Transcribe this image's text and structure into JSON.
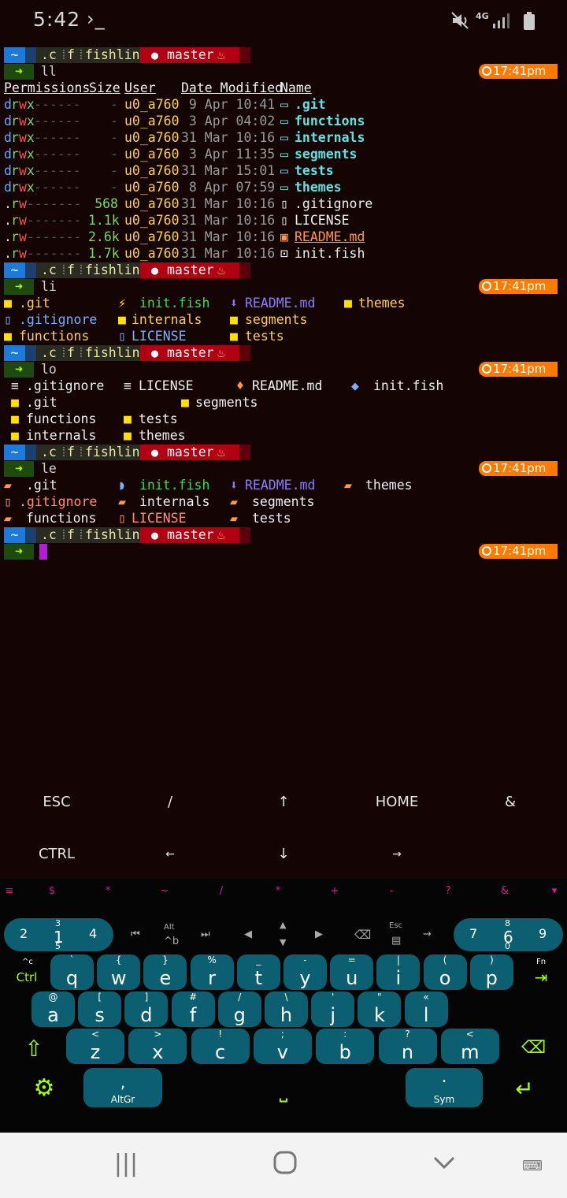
{
  "status": {
    "time": "5:42",
    "term_icon": "›_",
    "signal_label": "4G"
  },
  "prompt": {
    "home": "~",
    "path1": ".c",
    "path2": "f",
    "path3": "fishline",
    "branch": "master",
    "clock": "17:41pm",
    "arrow": "➜"
  },
  "cmds": {
    "c1": "ll",
    "c2": "li",
    "c3": "lo",
    "c4": "le"
  },
  "ll": {
    "headers": {
      "perm": "Permissions",
      "size": "Size",
      "user": "User",
      "date": "Date Modified",
      "name": "Name"
    },
    "rows": [
      {
        "d": "d",
        "rwx": "rwx",
        "rest": "------",
        "size": "-",
        "user": "u0_a760",
        "date": " 9 Apr 10:41",
        "name": ".git",
        "type": "dir"
      },
      {
        "d": "d",
        "rwx": "rwx",
        "rest": "------",
        "size": "-",
        "user": "u0_a760",
        "date": " 3 Apr 04:02",
        "name": "functions",
        "type": "dir"
      },
      {
        "d": "d",
        "rwx": "rwx",
        "rest": "------",
        "size": "-",
        "user": "u0_a760",
        "date": "31 Mar 10:16",
        "name": "internals",
        "type": "dir"
      },
      {
        "d": "d",
        "rwx": "rwx",
        "rest": "------",
        "size": "-",
        "user": "u0_a760",
        "date": " 3 Apr 11:35",
        "name": "segments",
        "type": "dir"
      },
      {
        "d": "d",
        "rwx": "rwx",
        "rest": "------",
        "size": "-",
        "user": "u0_a760",
        "date": "31 Mar 15:01",
        "name": "tests",
        "type": "dir"
      },
      {
        "d": "d",
        "rwx": "rwx",
        "rest": "------",
        "size": "-",
        "user": "u0_a760",
        "date": " 8 Apr 07:59",
        "name": "themes",
        "type": "dir"
      },
      {
        "d": ".",
        "rwx": "rw",
        "rest": "-------",
        "size": "568",
        "user": "u0_a760",
        "date": "31 Mar 10:16",
        "name": ".gitignore",
        "type": "file"
      },
      {
        "d": ".",
        "rwx": "rw",
        "rest": "-------",
        "size": "1.1k",
        "user": "u0_a760",
        "date": "31 Mar 10:16",
        "name": "LICENSE",
        "type": "file"
      },
      {
        "d": ".",
        "rwx": "rw",
        "rest": "-------",
        "size": "2.6k",
        "user": "u0_a760",
        "date": "31 Mar 10:16",
        "name": "README.md",
        "type": "md"
      },
      {
        "d": ".",
        "rwx": "rw",
        "rest": "-------",
        "size": "1.7k",
        "user": "u0_a760",
        "date": "31 Mar 10:16",
        "name": "init.fish",
        "type": "fish"
      }
    ]
  },
  "names": {
    "git": ".git",
    "gitignore": ".gitignore",
    "functions": "functions",
    "internals": "internals",
    "license": "LICENSE",
    "initfish": "init.fish",
    "readme": "README.md",
    "segments": "segments",
    "tests": "tests",
    "themes": "themes"
  },
  "extra_keys": {
    "esc": "ESC",
    "slash": "/",
    "up": "↑",
    "home": "HOME",
    "amp": "&",
    "ctrl": "CTRL",
    "left": "←",
    "down": "↓",
    "right": "→"
  },
  "symbols": [
    "≡",
    "$",
    "*",
    "~",
    "/",
    "*",
    "+",
    "-",
    "?",
    "&",
    "▾"
  ],
  "keyboard": {
    "num_left": {
      "a": "2",
      "b": "1",
      "b_up": "3",
      "b_dn": "5",
      "c": "4"
    },
    "num_right": {
      "a": "7",
      "b": "6",
      "b_up": "8",
      "b_dn": "0",
      "c": "9"
    },
    "mid": {
      "alt": "Alt",
      "altb": "^b",
      "esc": "Esc"
    },
    "row1": [
      {
        "k": "q",
        "s": "`"
      },
      {
        "k": "w",
        "s": "{"
      },
      {
        "k": "e",
        "s": "}"
      },
      {
        "k": "r",
        "s": "%"
      },
      {
        "k": "t",
        "s": "_"
      },
      {
        "k": "y",
        "s": "-"
      },
      {
        "k": "u",
        "s": "="
      },
      {
        "k": "i",
        "s": "|"
      },
      {
        "k": "o",
        "s": "("
      },
      {
        "k": "p",
        "s": ")"
      }
    ],
    "row2": [
      {
        "k": "a",
        "s": "@"
      },
      {
        "k": "s",
        "s": "["
      },
      {
        "k": "d",
        "s": "]"
      },
      {
        "k": "f",
        "s": "#"
      },
      {
        "k": "g",
        "s": "/"
      },
      {
        "k": "h",
        "s": "\\"
      },
      {
        "k": "j",
        "s": "'"
      },
      {
        "k": "k",
        "s": "\""
      },
      {
        "k": "l",
        "s": "«"
      }
    ],
    "row3": [
      {
        "k": "z",
        "s": "<"
      },
      {
        "k": "x",
        "s": ">"
      },
      {
        "k": "c",
        "s": "!"
      },
      {
        "k": "v",
        "s": ";"
      },
      {
        "k": "b",
        "s": ":"
      },
      {
        "k": "n",
        "s": "?"
      },
      {
        "k": "m",
        "s": "<"
      }
    ],
    "ctrl_small": "^c",
    "ctrl": "Ctrl",
    "fn": "Fn",
    "altgr_key": ",",
    "altgr": "AltGr",
    "sym_key": ".",
    "sym": "Sym",
    "space": "⎵"
  },
  "colors": {
    "bg": "#150404",
    "clock": "#ff7a00",
    "branch_bg": "#b00012",
    "path_bg": "#2b2b22",
    "accent_green": "#a8ff00",
    "key_bg": "#0b5f70",
    "sym_magenta": "#e0188c"
  }
}
